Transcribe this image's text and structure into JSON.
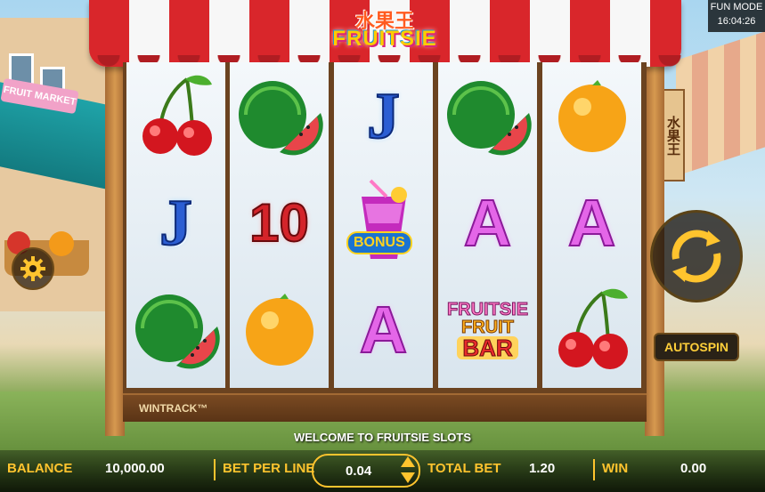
{
  "game": {
    "logo_cn": "水果王",
    "logo_en": "FRUITSIE",
    "stall_sign": "水果王",
    "left_sign": "FRUIT MARKET"
  },
  "mode": {
    "label": "FUN MODE",
    "clock": "16:04:26"
  },
  "reels": [
    [
      "cherry",
      "J",
      "watermelon"
    ],
    [
      "watermelon",
      "10",
      "orange"
    ],
    [
      "J",
      "bonus",
      "A"
    ],
    [
      "watermelon",
      "A",
      "fruitsie-fruit-bar"
    ],
    [
      "orange",
      "A",
      "cherry"
    ]
  ],
  "symbols": {
    "J": "J",
    "A": "A",
    "ten": "10",
    "bonus": "BONUS",
    "bar_line1": "FRUITSIE",
    "bar_line2": "FRUIT",
    "bar_line3": "BAR"
  },
  "wintrack": "WINTRACK™",
  "autospin_label": "AUTOSPIN",
  "welcome": "WELCOME TO FRUITSIE SLOTS",
  "bottom_bar": {
    "balance_label": "BALANCE",
    "balance_value": "10,000.00",
    "bet_per_line_label": "BET PER LINE",
    "bet_per_line_value": "0.04",
    "total_bet_label": "TOTAL BET",
    "total_bet_value": "1.20",
    "win_label": "WIN",
    "win_value": "0.00"
  },
  "colors": {
    "accent": "#ffc42e",
    "awning_red": "#d9262b",
    "awning_white": "#f7f7f7"
  }
}
